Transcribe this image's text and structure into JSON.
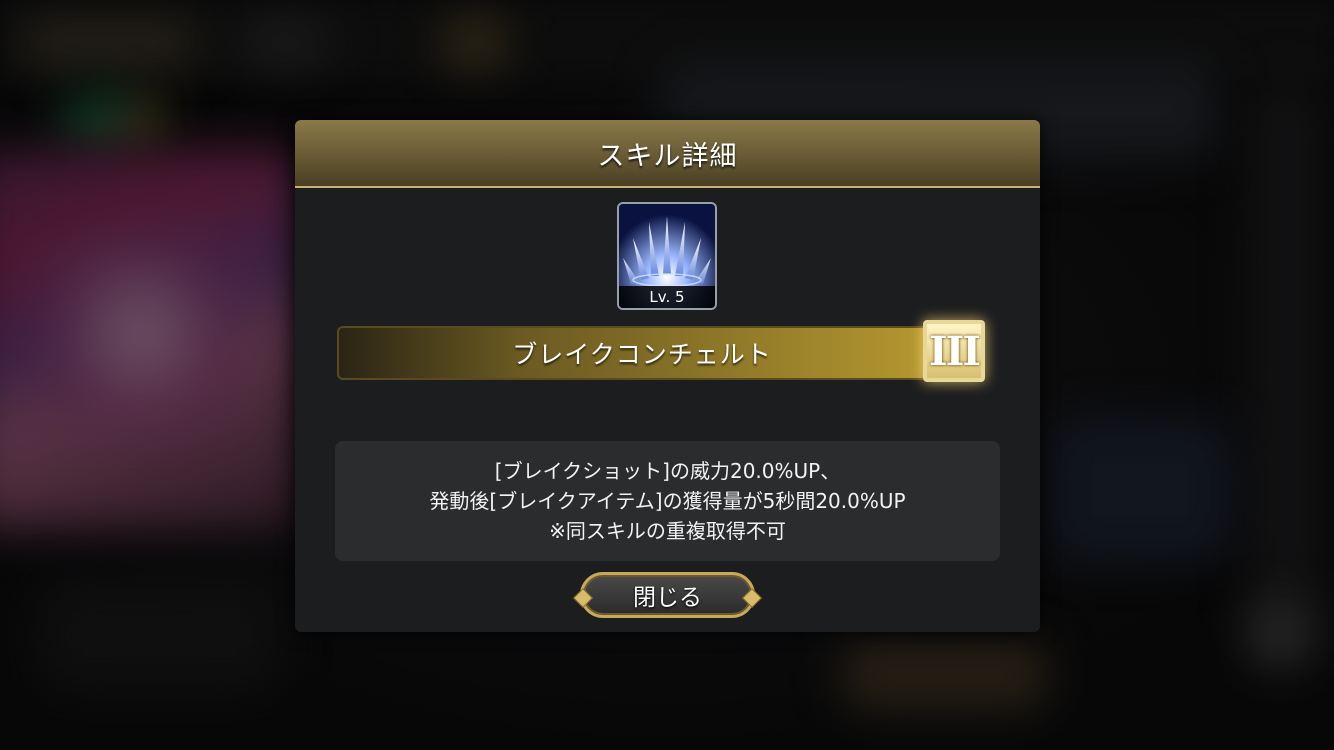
{
  "dialog": {
    "title": "スキル詳細",
    "skill": {
      "level_label": "Lv. 5",
      "name": "ブレイクコンチェルト",
      "rank": "III"
    },
    "description": {
      "lines": [
        "[ブレイクショット]の威力20.0%UP、",
        "発動後[ブレイクアイテム]の獲得量が5秒間20.0%UP",
        "※同スキルの重複取得不可"
      ]
    },
    "close_label": "閉じる"
  },
  "colors": {
    "header_gold": "#6b5d36",
    "panel": "#1c1d1f",
    "desc_box": "#2b2c2e",
    "accent_gold": "#c9a85a"
  },
  "icons": {
    "skill_icon": "ice-shards-icon"
  }
}
